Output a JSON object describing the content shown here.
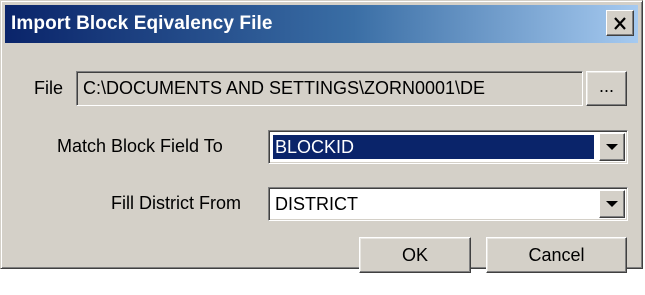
{
  "window": {
    "title": "Import Block Eqivalency File",
    "close_symbol": "✕"
  },
  "file": {
    "label": "File",
    "value": "C:\\DOCUMENTS AND SETTINGS\\ZORN0001\\DE",
    "browse_label": "..."
  },
  "match_block": {
    "label": "Match Block Field To",
    "selected": "BLOCKID"
  },
  "fill_district": {
    "label": "Fill District From",
    "selected": "DISTRICT"
  },
  "buttons": {
    "ok": "OK",
    "cancel": "Cancel"
  },
  "icons": {
    "close": "close-icon",
    "dropdown": "chevron-down-icon"
  }
}
